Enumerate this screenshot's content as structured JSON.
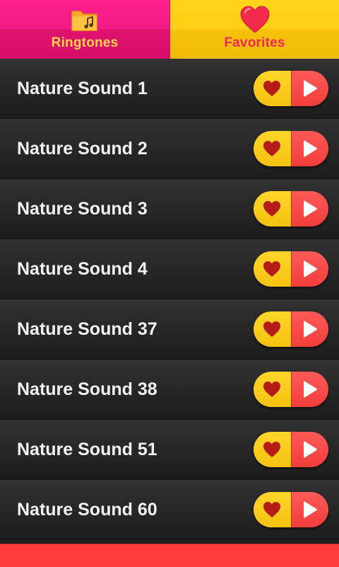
{
  "tabs": {
    "ringtones": {
      "label": "Ringtones",
      "icon": "music-folder-icon"
    },
    "favorites": {
      "label": "Favorites",
      "icon": "heart-icon"
    }
  },
  "ringtones": [
    {
      "title": "Nature Sound 1"
    },
    {
      "title": "Nature Sound 2"
    },
    {
      "title": "Nature Sound 3"
    },
    {
      "title": "Nature Sound 4"
    },
    {
      "title": "Nature Sound 37"
    },
    {
      "title": "Nature Sound 38"
    },
    {
      "title": "Nature Sound 51"
    },
    {
      "title": "Nature Sound 60"
    }
  ],
  "colors": {
    "ringtones_tab": "#f21c85",
    "favorites_tab": "#ffcf14",
    "play_button": "#ff4f4d",
    "favorite_button": "#ffd62a",
    "heart": "#b51c17",
    "bottom_bar": "#ff3b3b"
  }
}
